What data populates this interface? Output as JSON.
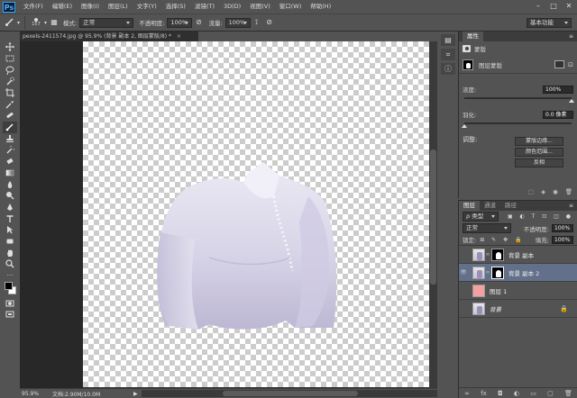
{
  "app": {
    "logo": "Ps"
  },
  "menubar": {
    "items": [
      "文件(F)",
      "编辑(E)",
      "图像(I)",
      "图层(L)",
      "文字(Y)",
      "选择(S)",
      "滤镜(T)",
      "3D(D)",
      "视图(V)",
      "窗口(W)",
      "帮助(H)"
    ],
    "window_controls": [
      "–",
      "□",
      "✕"
    ]
  },
  "options_bar": {
    "brush_size": "157",
    "mode_label": "模式:",
    "mode_value": "正常",
    "opacity_label": "不透明度:",
    "opacity_value": "100%",
    "flow_label": "流量:",
    "flow_value": "100%",
    "workspace": "基本功能"
  },
  "document": {
    "tab_title": "pexels-2411574.jpg @ 95.9% (背景 副本 2, 图层蒙版/8) *",
    "tab_close": "×",
    "zoom": "95.9%",
    "doc_info": "文档:2.90M/10.0M"
  },
  "properties": {
    "tab": "属性",
    "mask_type": "蒙版",
    "mask_name": "图层蒙版",
    "density_label": "浓度:",
    "density_value": "100%",
    "feather_label": "羽化:",
    "feather_value": "0.0 像素",
    "density_fraction": 1.0,
    "feather_fraction": 0.0,
    "adjust_label": "调整:",
    "buttons": [
      "蒙版边缘...",
      "颜色范围...",
      "反相"
    ]
  },
  "layers": {
    "tabs": [
      "图层",
      "通道",
      "路径"
    ],
    "filter_label": "ρ 类型",
    "blend_mode": "正常",
    "opacity_label": "不透明度:",
    "opacity_value": "100%",
    "lock_label": "锁定:",
    "fill_label": "填充:",
    "fill_value": "100%",
    "items": [
      {
        "name": "背景 副本",
        "visible": false,
        "has_mask": true,
        "thumb": "photo",
        "selected": false
      },
      {
        "name": "背景 副本 2",
        "visible": true,
        "has_mask": true,
        "thumb": "photo",
        "selected": true
      },
      {
        "name": "图层 1",
        "visible": false,
        "has_mask": false,
        "thumb": "pink",
        "selected": false
      },
      {
        "name": "背景",
        "visible": false,
        "has_mask": false,
        "thumb": "photo",
        "selected": false,
        "locked": true
      }
    ],
    "footer_icons": [
      "link-icon",
      "fx-icon",
      "mask-icon",
      "adjustment-icon",
      "group-icon",
      "new-layer-icon",
      "trash-icon"
    ]
  },
  "colors": {
    "foreground": "#000000",
    "background": "#ffffff",
    "shirt": "#d9d7ea",
    "selected_layer": "#63708a",
    "pink_fill": "#f2a0a0"
  }
}
